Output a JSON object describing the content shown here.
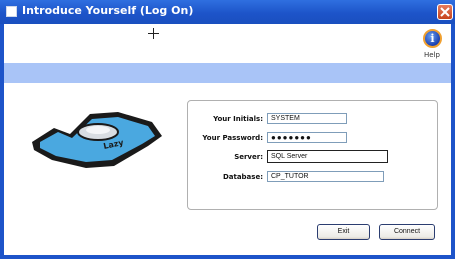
{
  "window": {
    "title": "Introduce Yourself (Log On)"
  },
  "toolbar": {
    "help_label": "Help"
  },
  "logo": {
    "text": "Lazy"
  },
  "form": {
    "initials_label": "Your Initials:",
    "initials_value": "SYSTEM",
    "password_label": "Your Password:",
    "password_value": "●●●●●●●",
    "server_label": "Server:",
    "server_value": "SQL Server",
    "database_label": "Database:",
    "database_value": "CP_TUTOR"
  },
  "buttons": {
    "exit_label": "Exit",
    "connect_label": "Connect"
  },
  "colors": {
    "titlebar": "#1d54c9",
    "band": "#a9c4f7",
    "logo_blue": "#4aa8e0"
  }
}
